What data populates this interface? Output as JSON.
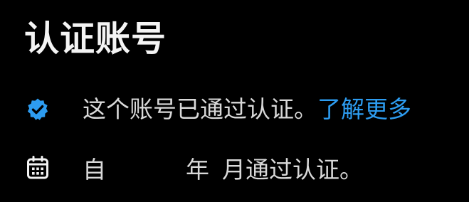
{
  "title": "认证账号",
  "verified": {
    "icon": "verified-badge-icon",
    "text": "这个账号已通过认证。",
    "link": "了解更多",
    "link_color": "#2d9cf0",
    "badge_color": "#2d9cf0"
  },
  "date": {
    "icon": "calendar-icon",
    "prefix": "自",
    "year_unit": "年",
    "month_text": "月通过认证。"
  }
}
